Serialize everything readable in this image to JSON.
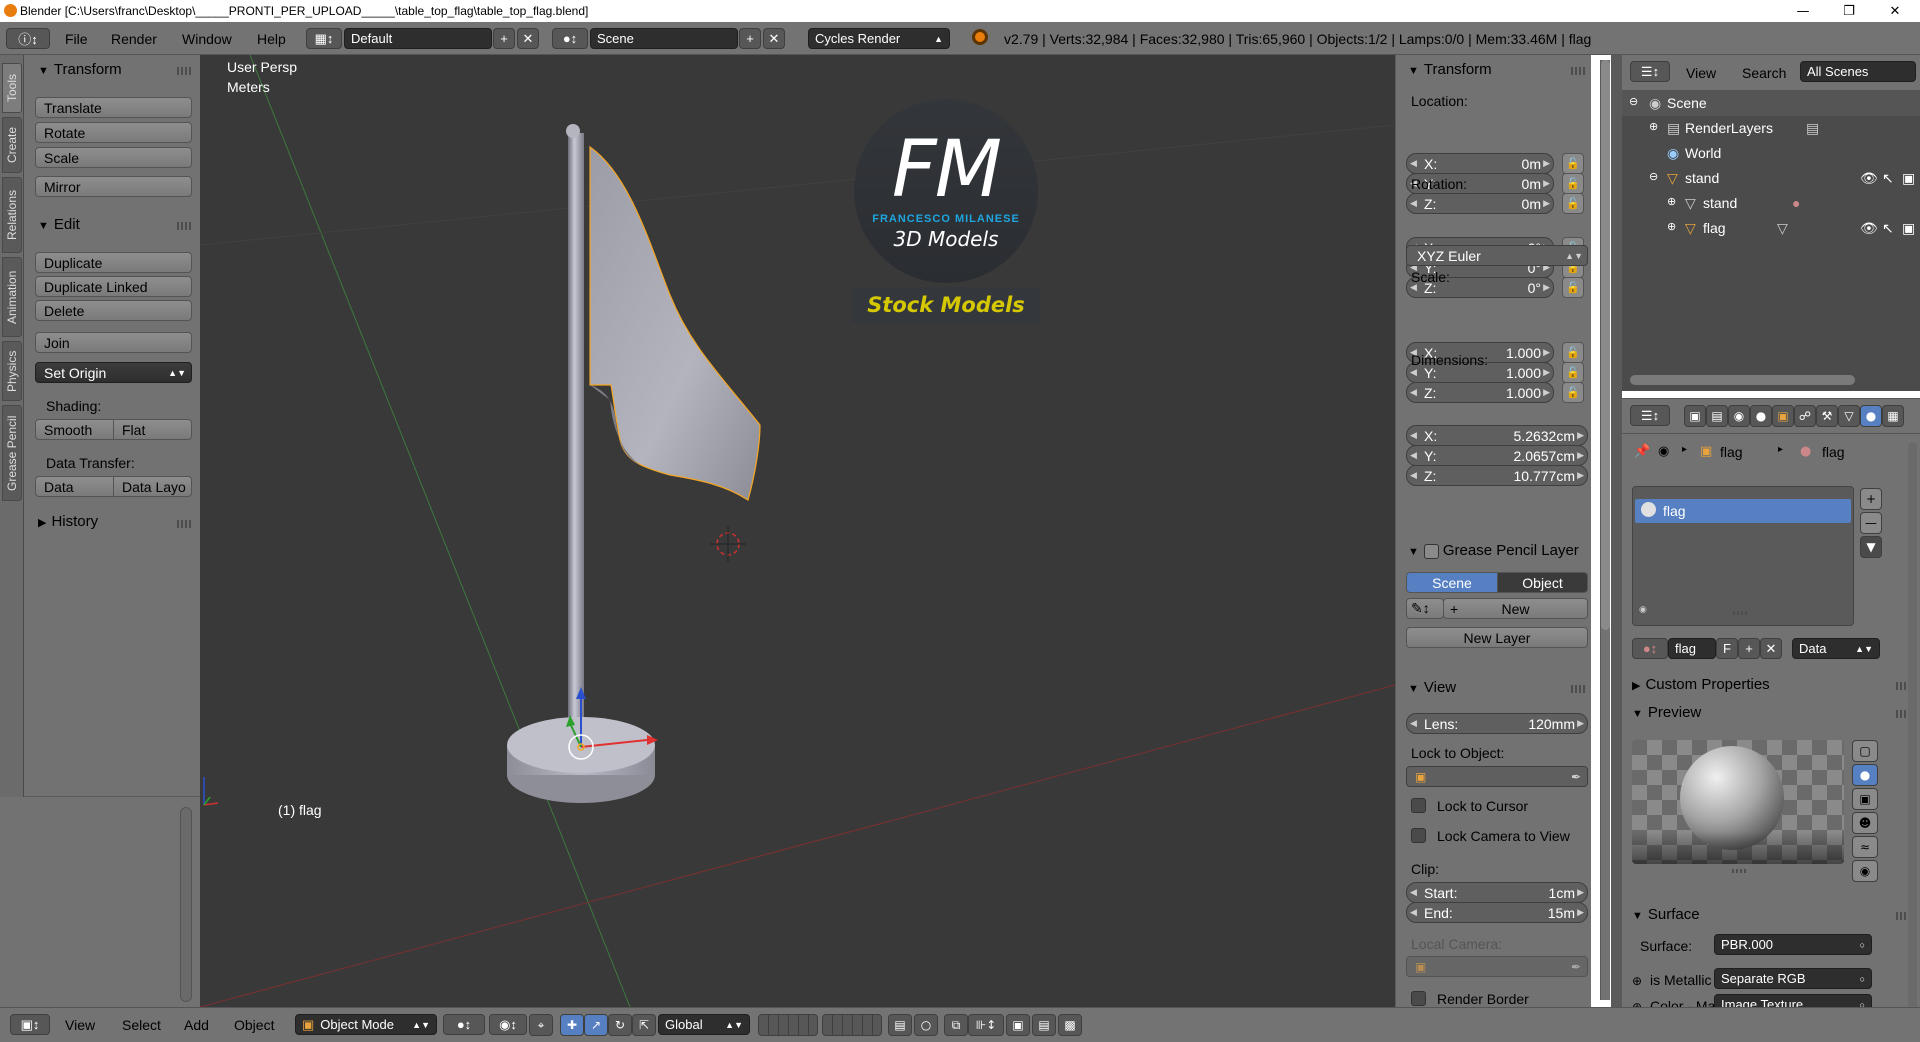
{
  "window": {
    "title": "Blender [C:\\Users\\franc\\Desktop\\_____PRONTI_PER_UPLOAD_____\\table_top_flag\\table_top_flag.blend]"
  },
  "infobar": {
    "menus": [
      "File",
      "Render",
      "Window",
      "Help"
    ],
    "layout": "Default",
    "scene": "Scene",
    "engine": "Cycles Render",
    "stats": "v2.79 | Verts:32,984 | Faces:32,980 | Tris:65,960 | Objects:1/2 | Lamps:0/0 | Mem:33.46M | flag"
  },
  "toolshelf": {
    "tabs": [
      "Tools",
      "Create",
      "Relations",
      "Animation",
      "Physics",
      "Grease Pencil"
    ],
    "transform_title": "Transform",
    "transform_buttons": [
      "Translate",
      "Rotate",
      "Scale",
      "Mirror"
    ],
    "edit_title": "Edit",
    "edit_buttons": [
      "Duplicate",
      "Duplicate Linked",
      "Delete",
      "Join"
    ],
    "set_origin": "Set Origin",
    "shading_label": "Shading:",
    "smooth": "Smooth",
    "flat": "Flat",
    "data_transfer_label": "Data Transfer:",
    "data": "Data",
    "data_layout": "Data Layo",
    "history": "History"
  },
  "viewport": {
    "view_name": "User Persp",
    "units": "Meters",
    "object_label": "(1) flag",
    "logo_letters": "FM",
    "logo_name": "FRANCESCO MILANESE",
    "logo_sub": "3D Models",
    "logo_stock": "Stock Models"
  },
  "npanel": {
    "transform_title": "Transform",
    "location_label": "Location:",
    "location": [
      {
        "k": "X:",
        "v": "0m"
      },
      {
        "k": "Y:",
        "v": "0m"
      },
      {
        "k": "Z:",
        "v": "0m"
      }
    ],
    "rotation_label": "Rotation:",
    "rotation": [
      {
        "k": "X:",
        "v": "0°"
      },
      {
        "k": "Y:",
        "v": "0°"
      },
      {
        "k": "Z:",
        "v": "0°"
      }
    ],
    "rotation_mode": "XYZ Euler",
    "scale_label": "Scale:",
    "scale": [
      {
        "k": "X:",
        "v": "1.000"
      },
      {
        "k": "Y:",
        "v": "1.000"
      },
      {
        "k": "Z:",
        "v": "1.000"
      }
    ],
    "dimensions_label": "Dimensions:",
    "dimensions": [
      {
        "k": "X:",
        "v": "5.2632cm"
      },
      {
        "k": "Y:",
        "v": "2.0657cm"
      },
      {
        "k": "Z:",
        "v": "10.777cm"
      }
    ],
    "gp_title": "Grease Pencil Layer",
    "gp_scene": "Scene",
    "gp_object": "Object",
    "gp_new": "New",
    "gp_new_layer": "New Layer",
    "view_title": "View",
    "lens_k": "Lens:",
    "lens_v": "120mm",
    "lock_to_object": "Lock to Object:",
    "lock_to_cursor": "Lock to Cursor",
    "lock_camera": "Lock Camera to View",
    "clip_label": "Clip:",
    "clip_start_k": "Start:",
    "clip_start_v": "1cm",
    "clip_end_k": "End:",
    "clip_end_v": "15m",
    "local_camera": "Local Camera:",
    "render_border": "Render Border"
  },
  "outliner": {
    "view": "View",
    "search": "Search",
    "filter": "All Scenes",
    "rows": [
      "Scene",
      "RenderLayers",
      "World",
      "stand",
      "stand",
      "flag"
    ]
  },
  "properties": {
    "breadcrumb_obj": "flag",
    "breadcrumb_mat": "flag",
    "slot": "flag",
    "material_name": "flag",
    "fake_user": "F",
    "link": "Data",
    "custom_props": "Custom Properties",
    "preview": "Preview",
    "surface_title": "Surface",
    "surface_label": "Surface:",
    "surface_value": "PBR.000",
    "metallic_label": "is Metallic",
    "metallic_value": "Separate RGB",
    "color_label": "Color - Ma",
    "color_value": "Image Texture"
  },
  "bottombar": {
    "menus": [
      "View",
      "Select",
      "Add",
      "Object"
    ],
    "mode": "Object Mode",
    "orientation": "Global"
  },
  "colors": {
    "selection_outline": "#f5a623",
    "blue_logo": "#1ea6e0",
    "stock_yellow": "#d6c800",
    "active_blue": "#5680c2"
  }
}
